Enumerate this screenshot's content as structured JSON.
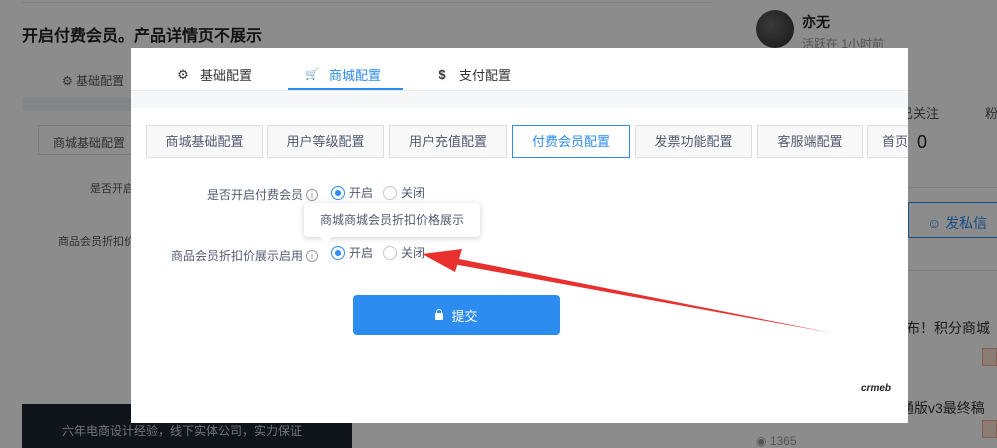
{
  "background": {
    "title": "开启付费会员。产品详情页不展示",
    "tab_basic": "基础配置",
    "subtab": "商城基础配置",
    "label1": "是否开启",
    "label2": "商品会员折扣价",
    "banner": "六年电商设计经验，线下实体公司，实力保证",
    "sidebar": {
      "username": "亦无",
      "active": "活跃在 1小时前",
      "follow_label": "已关注",
      "fans_label": "粉",
      "count": "0",
      "message_button": "发私信",
      "post1": "布！积分商城",
      "post2": "通版v3最终稿",
      "views": "1365"
    }
  },
  "modal": {
    "top_tabs": [
      {
        "label": "基础配置",
        "icon": "gear-icon",
        "glyph": "⚙"
      },
      {
        "label": "商城配置",
        "icon": "cart-icon",
        "glyph": "🛒"
      },
      {
        "label": "支付配置",
        "icon": "dollar-icon",
        "glyph": "$"
      }
    ],
    "active_top_tab": "商城配置",
    "sub_tabs": [
      "商城基础配置",
      "用户等级配置",
      "用户充值配置",
      "付费会员配置",
      "发票功能配置",
      "客服端配置",
      "首页"
    ],
    "active_sub_tab": "付费会员配置",
    "fields": [
      {
        "label": "是否开启付费会员",
        "options": [
          "开启",
          "关闭"
        ],
        "selected": "开启"
      },
      {
        "label": "商品会员折扣价展示启用",
        "options": [
          "开启",
          "关闭"
        ],
        "selected": "开启"
      }
    ],
    "tooltip": "商城商城会员折扣价格展示",
    "submit_label": "提交",
    "brand": "crmeb"
  },
  "colors": {
    "accent": "#2d8cf0",
    "arrow": "#e8312f",
    "overlay": "rgba(0,0,0,0.45)"
  }
}
